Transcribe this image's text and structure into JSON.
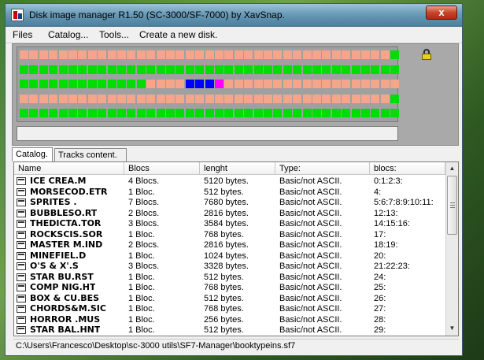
{
  "window": {
    "title": "Disk image manager R1.50 (SC-3000/SF-7000) by XavSnap.",
    "close_label": "x"
  },
  "menu": [
    "Files",
    "Catalog...",
    "Tools...",
    "Create a new disk."
  ],
  "colors": {
    "free": "#f4a58a",
    "used": "#00dd00",
    "selected": "#0000ff",
    "highlight": "#ff00ff",
    "grid_bg": "#a0a0a0"
  },
  "block_map": {
    "rows": [
      "FFFFFFFFFFFFFFFFFFFFFFFFFFFFFFFFFFFFFFG",
      "GGGGGGGGGGGGGGGGGGGGGGGGGGGGGGGGGGGGGGG",
      "GGGGGGGGGGGGGFFFFBBBMFFFFFFFFFFFFFFFFFF",
      "FFFFFFFFFFFFFFFFFFFFFFFFFFFFFFFFFFFFFFG",
      "GGGGGGGGGGGGGGGGGGGGGGGGGGGGGGGGGGGGGGG"
    ],
    "legend": {
      "F": "free",
      "G": "used",
      "B": "selected",
      "M": "highlight"
    }
  },
  "tabs": [
    "Catalog.",
    "Tracks content."
  ],
  "columns": [
    "Name",
    "Blocs",
    "lenght",
    "Type:",
    "blocs:"
  ],
  "rows": [
    [
      "ICE CREA.M",
      "4 Blocs.",
      "5120 bytes.",
      "Basic/not ASCII.",
      "0:1:2:3:"
    ],
    [
      "MORSECOD.ETR",
      "1 Bloc.",
      "512 bytes.",
      "Basic/not ASCII.",
      "4:"
    ],
    [
      "SPRITES .",
      "7 Blocs.",
      "7680 bytes.",
      "Basic/not ASCII.",
      "5:6:7:8:9:10:11:"
    ],
    [
      "BUBBLESO.RT",
      "2 Blocs.",
      "2816 bytes.",
      "Basic/not ASCII.",
      "12:13:"
    ],
    [
      "THEDICTA.TOR",
      "3 Blocs.",
      "3584 bytes.",
      "Basic/not ASCII.",
      "14:15:16:"
    ],
    [
      "ROCKSCIS.SOR",
      "1 Bloc.",
      "768 bytes.",
      "Basic/not ASCII.",
      "17:"
    ],
    [
      "MASTER M.IND",
      "2 Blocs.",
      "2816 bytes.",
      "Basic/not ASCII.",
      "18:19:"
    ],
    [
      "MINEFIEL.D",
      "1 Bloc.",
      "1024 bytes.",
      "Basic/not ASCII.",
      "20:"
    ],
    [
      "O'S & X'.S",
      "3 Blocs.",
      "3328 bytes.",
      "Basic/not ASCII.",
      "21:22:23:"
    ],
    [
      "STAR  BU.RST",
      "1 Bloc.",
      "512 bytes.",
      "Basic/not ASCII.",
      "24:"
    ],
    [
      "COMP NIG.HT",
      "1 Bloc.",
      "768 bytes.",
      "Basic/not ASCII.",
      "25:"
    ],
    [
      "BOX & CU.BES",
      "1 Bloc.",
      "512 bytes.",
      "Basic/not ASCII.",
      "26:"
    ],
    [
      "CHORDS&M.SIC",
      "1 Bloc.",
      "768 bytes.",
      "Basic/not ASCII.",
      "27:"
    ],
    [
      "HORROR  .MUS",
      "1 Bloc.",
      "256 bytes.",
      "Basic/not ASCII.",
      "28:"
    ],
    [
      "STAR BAL.HNT",
      "1 Bloc.",
      "512 bytes.",
      "Basic/not ASCII.",
      "29:"
    ]
  ],
  "path": "C:\\Users\\Francesco\\Desktop\\sc-3000 utils\\SF7-Manager\\booktypeins.sf7"
}
